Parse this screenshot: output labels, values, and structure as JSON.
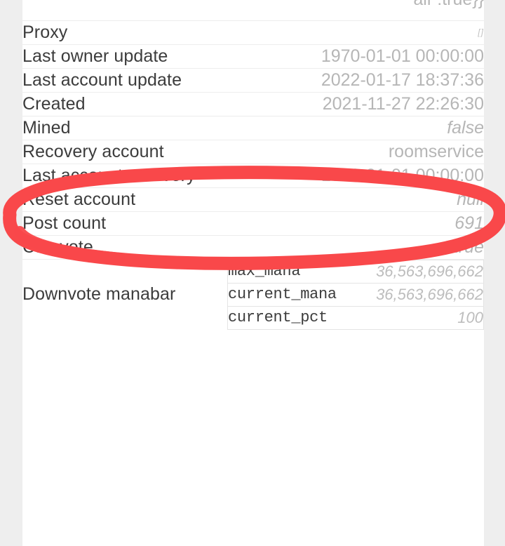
{
  "meta": {
    "accent_red": "#f9484a",
    "background": "#eeeeee",
    "card_background": "#ffffff",
    "label_color": "#3c3c3c",
    "value_color": "#b6b6b6"
  },
  "clipped_top_row": {
    "value": "ail\":true}}"
  },
  "rows": [
    {
      "label": "Proxy",
      "value": "[]",
      "style": "tiny"
    },
    {
      "label": "Last owner update",
      "value": "1970-01-01 00:00:00",
      "style": "plain"
    },
    {
      "label": "Last account update",
      "value": "2022-01-17 18:37:36",
      "style": "plain"
    },
    {
      "label": "Created",
      "value": "2021-11-27 22:26:30",
      "style": "plain"
    },
    {
      "label": "Mined",
      "value": "false",
      "style": "lit"
    },
    {
      "label": "Recovery account",
      "value": "roomservice",
      "style": "plain"
    },
    {
      "label": "Last account recovery",
      "value": "1970-01-01 00:00:00",
      "style": "plain"
    },
    {
      "label": "Reset account",
      "value": "null",
      "style": "lit"
    },
    {
      "label": "Post count",
      "value": "691",
      "style": "lit"
    },
    {
      "label": "Can vote",
      "value": "true",
      "style": "lit"
    }
  ],
  "manabar": {
    "label": "Downvote manabar",
    "entries": [
      {
        "key": "max_mana",
        "value": "36,563,696,662"
      },
      {
        "key": "current_mana",
        "value": "36,563,696,662"
      },
      {
        "key": "current_pct",
        "value": "100"
      }
    ]
  },
  "annotation": {
    "kind": "hand-drawn-ellipse",
    "color": "#f9484a",
    "highlights_row_label": "Recovery account",
    "highlights_row_value": "roomservice"
  }
}
